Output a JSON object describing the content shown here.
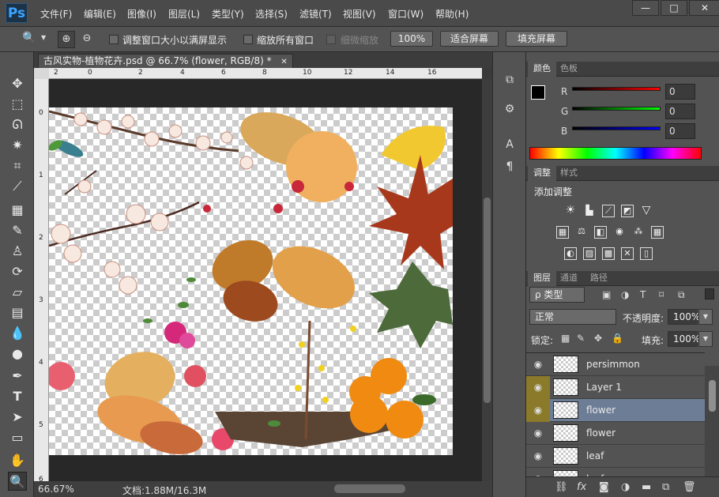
{
  "app": {
    "logo": "Ps"
  },
  "menu": [
    "文件(F)",
    "编辑(E)",
    "图像(I)",
    "图层(L)",
    "类型(Y)",
    "选择(S)",
    "滤镜(T)",
    "视图(V)",
    "窗口(W)",
    "帮助(H)"
  ],
  "window_controls": {
    "minimize": "—",
    "maximize": "□",
    "close": "✕"
  },
  "options": {
    "zoom_icon": "🔍",
    "fit_window_label": "调整窗口大小以满屏显示",
    "zoom_all_label": "缩放所有窗口",
    "scrubby_label": "细微缩放",
    "percent_button": "100%",
    "fit_screen_button": "适合屏幕",
    "fill_screen_button": "填充屏幕"
  },
  "document": {
    "tab_title": "古风实物-植物花卉.psd @ 66.7% (flower, RGB/8) *",
    "close": "✕",
    "ruler_h_labels": [
      "2",
      "0",
      "2",
      "4",
      "6",
      "8",
      "10",
      "12",
      "14",
      "16"
    ],
    "ruler_v_labels": [
      "0",
      "1",
      "2",
      "3",
      "4",
      "5",
      "6"
    ]
  },
  "status": {
    "zoom": "66.67%",
    "doc_info": "文档:1.88M/16.3M"
  },
  "panels": {
    "color": {
      "tabs": [
        "颜色",
        "色板"
      ],
      "channels": [
        {
          "label": "R",
          "value": "0"
        },
        {
          "label": "G",
          "value": "0"
        },
        {
          "label": "B",
          "value": "0"
        }
      ]
    },
    "adjustments": {
      "tabs": [
        "调整",
        "样式"
      ],
      "title": "添加调整"
    },
    "layers": {
      "tabs": [
        "图层",
        "通道",
        "路径"
      ],
      "filter_kind": "ρ 类型",
      "blend_mode": "正常",
      "opacity_label": "不透明度:",
      "opacity_value": "100%",
      "lock_label": "锁定:",
      "fill_label": "填充:",
      "fill_value": "100%",
      "items": [
        {
          "name": "persimmon"
        },
        {
          "name": "Layer 1"
        },
        {
          "name": "flower"
        },
        {
          "name": "flower"
        },
        {
          "name": "leaf"
        },
        {
          "name": "leaf"
        }
      ],
      "footer_icons": [
        "link-icon",
        "fx-icon",
        "mask-icon",
        "adjustment-icon",
        "group-icon",
        "new-layer-icon",
        "trash-icon"
      ]
    }
  }
}
